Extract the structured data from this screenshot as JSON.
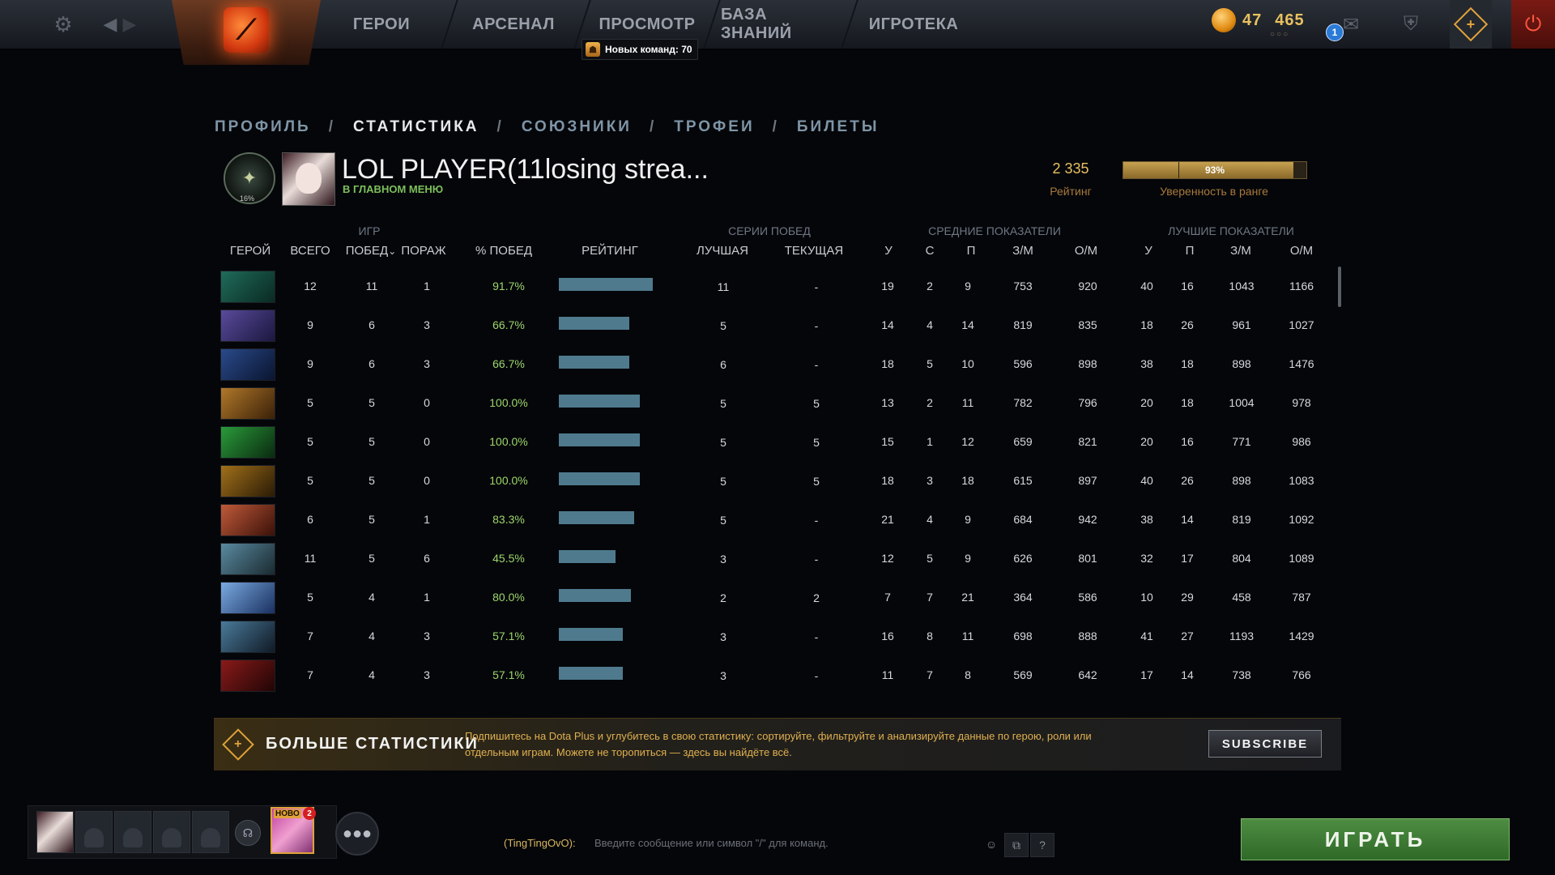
{
  "topbar": {
    "nav": [
      "ГЕРОИ",
      "АРСЕНАЛ",
      "ПРОСМОТР",
      "БАЗА ЗНАНИЙ",
      "ИГРОТЕКА"
    ],
    "new_teams": "Новых команд: 70",
    "currency_a": "47",
    "currency_b": "465",
    "currency_dots": "○○○",
    "mail_count": "1"
  },
  "breadcrumbs": [
    "ПРОФИЛЬ",
    "СТАТИСТИКА",
    "СОЮЗНИКИ",
    "ТРОФЕИ",
    "БИЛЕТЫ"
  ],
  "breadcrumb_sep": "/",
  "profile": {
    "rank_pct": "16%",
    "name": "LOL PLAYER(11losing strea...",
    "status": "В ГЛАВНОМ МЕНЮ",
    "rating_value": "2 335",
    "rating_label": "Рейтинг",
    "confidence": 0.93,
    "confidence_text": "93%",
    "confidence_label": "Уверенность в ранге"
  },
  "table": {
    "groups": {
      "games": "ИГР",
      "streaks": "СЕРИИ ПОБЕД",
      "averages": "СРЕДНИЕ ПОКАЗАТЕЛИ",
      "best": "ЛУЧШИЕ ПОКАЗАТЕЛИ"
    },
    "columns": [
      "ГЕРОЙ",
      "ВСЕГО",
      "ПОБЕД",
      "ПОРАЖ",
      "% ПОБЕД",
      "РЕЙТИНГ",
      "ЛУЧШАЯ",
      "ТЕКУЩАЯ",
      "У",
      "С",
      "П",
      "З/М",
      "О/М",
      "У",
      "П",
      "З/М",
      "О/М"
    ],
    "sort_indicator": "⌄",
    "rows": [
      {
        "hero": "hero-1",
        "colors": [
          "#1f6b5a",
          "#0a2a22"
        ],
        "total": "12",
        "wins": "11",
        "losses": "1",
        "winpct": "91.7%",
        "rating": 1.0,
        "best": "11",
        "current": "-",
        "k": "19",
        "d": "2",
        "a": "9",
        "gpm": "753",
        "xpm": "920",
        "bk": "40",
        "ba": "16",
        "bgpm": "1043",
        "bxpm": "1166"
      },
      {
        "hero": "hero-2",
        "colors": [
          "#5a4a9a",
          "#1a1840"
        ],
        "total": "9",
        "wins": "6",
        "losses": "3",
        "winpct": "66.7%",
        "rating": 0.75,
        "best": "5",
        "current": "-",
        "k": "14",
        "d": "4",
        "a": "14",
        "gpm": "819",
        "xpm": "835",
        "bk": "18",
        "ba": "26",
        "bgpm": "961",
        "bxpm": "1027"
      },
      {
        "hero": "hero-3",
        "colors": [
          "#2a4a8a",
          "#0a1530"
        ],
        "total": "9",
        "wins": "6",
        "losses": "3",
        "winpct": "66.7%",
        "rating": 0.75,
        "best": "6",
        "current": "-",
        "k": "18",
        "d": "5",
        "a": "10",
        "gpm": "596",
        "xpm": "898",
        "bk": "38",
        "ba": "18",
        "bgpm": "898",
        "bxpm": "1476"
      },
      {
        "hero": "hero-4",
        "colors": [
          "#b0782a",
          "#3a2008"
        ],
        "total": "5",
        "wins": "5",
        "losses": "0",
        "winpct": "100.0%",
        "rating": 0.86,
        "best": "5",
        "current": "5",
        "k": "13",
        "d": "2",
        "a": "11",
        "gpm": "782",
        "xpm": "796",
        "bk": "20",
        "ba": "18",
        "bgpm": "1004",
        "bxpm": "978"
      },
      {
        "hero": "hero-5",
        "colors": [
          "#2a9a3a",
          "#0a2a10"
        ],
        "total": "5",
        "wins": "5",
        "losses": "0",
        "winpct": "100.0%",
        "rating": 0.86,
        "best": "5",
        "current": "5",
        "k": "15",
        "d": "1",
        "a": "12",
        "gpm": "659",
        "xpm": "821",
        "bk": "20",
        "ba": "16",
        "bgpm": "771",
        "bxpm": "986"
      },
      {
        "hero": "hero-6",
        "colors": [
          "#a0701a",
          "#2a1a05"
        ],
        "total": "5",
        "wins": "5",
        "losses": "0",
        "winpct": "100.0%",
        "rating": 0.86,
        "best": "5",
        "current": "5",
        "k": "18",
        "d": "3",
        "a": "18",
        "gpm": "615",
        "xpm": "897",
        "bk": "40",
        "ba": "26",
        "bgpm": "898",
        "bxpm": "1083"
      },
      {
        "hero": "hero-7",
        "colors": [
          "#c05a3a",
          "#3a1008"
        ],
        "total": "6",
        "wins": "5",
        "losses": "1",
        "winpct": "83.3%",
        "rating": 0.8,
        "best": "5",
        "current": "-",
        "k": "21",
        "d": "4",
        "a": "9",
        "gpm": "684",
        "xpm": "942",
        "bk": "38",
        "ba": "14",
        "bgpm": "819",
        "bxpm": "1092"
      },
      {
        "hero": "hero-8",
        "colors": [
          "#5a8aa0",
          "#1a2a30"
        ],
        "total": "11",
        "wins": "5",
        "losses": "6",
        "winpct": "45.5%",
        "rating": 0.6,
        "best": "3",
        "current": "-",
        "k": "12",
        "d": "5",
        "a": "9",
        "gpm": "626",
        "xpm": "801",
        "bk": "32",
        "ba": "17",
        "bgpm": "804",
        "bxpm": "1089"
      },
      {
        "hero": "hero-9",
        "colors": [
          "#7aaae0",
          "#1a3060"
        ],
        "total": "5",
        "wins": "4",
        "losses": "1",
        "winpct": "80.0%",
        "rating": 0.77,
        "best": "2",
        "current": "2",
        "k": "7",
        "d": "7",
        "a": "21",
        "gpm": "364",
        "xpm": "586",
        "bk": "10",
        "ba": "29",
        "bgpm": "458",
        "bxpm": "787"
      },
      {
        "hero": "hero-10",
        "colors": [
          "#4a7a9a",
          "#101a25"
        ],
        "total": "7",
        "wins": "4",
        "losses": "3",
        "winpct": "57.1%",
        "rating": 0.68,
        "best": "3",
        "current": "-",
        "k": "16",
        "d": "8",
        "a": "11",
        "gpm": "698",
        "xpm": "888",
        "bk": "41",
        "ba": "27",
        "bgpm": "1193",
        "bxpm": "1429"
      },
      {
        "hero": "hero-11",
        "colors": [
          "#8a1a1a",
          "#200505"
        ],
        "total": "7",
        "wins": "4",
        "losses": "3",
        "winpct": "57.1%",
        "rating": 0.68,
        "best": "3",
        "current": "-",
        "k": "11",
        "d": "7",
        "a": "8",
        "gpm": "569",
        "xpm": "642",
        "bk": "17",
        "ba": "14",
        "bgpm": "738",
        "bxpm": "766"
      }
    ]
  },
  "banner": {
    "title": "БОЛЬШЕ СТАТИСТИКИ",
    "text": "Подпишитесь на Dota Plus и углубитесь в свою статистику: сортируйте, фильтруйте и анализируйте данные по герою, роли или отдельным играм. Можете не торопиться — здесь вы найдёте всё.",
    "subscribe": "SUBSCRIBE"
  },
  "bottom": {
    "new_tag": "НОВО",
    "new_count": "2",
    "chat_name": "(TingTingOvO):",
    "chat_placeholder": "Введите сообщение или символ \"/\" для команд.",
    "help": "?",
    "play": "ИГРАТЬ"
  }
}
